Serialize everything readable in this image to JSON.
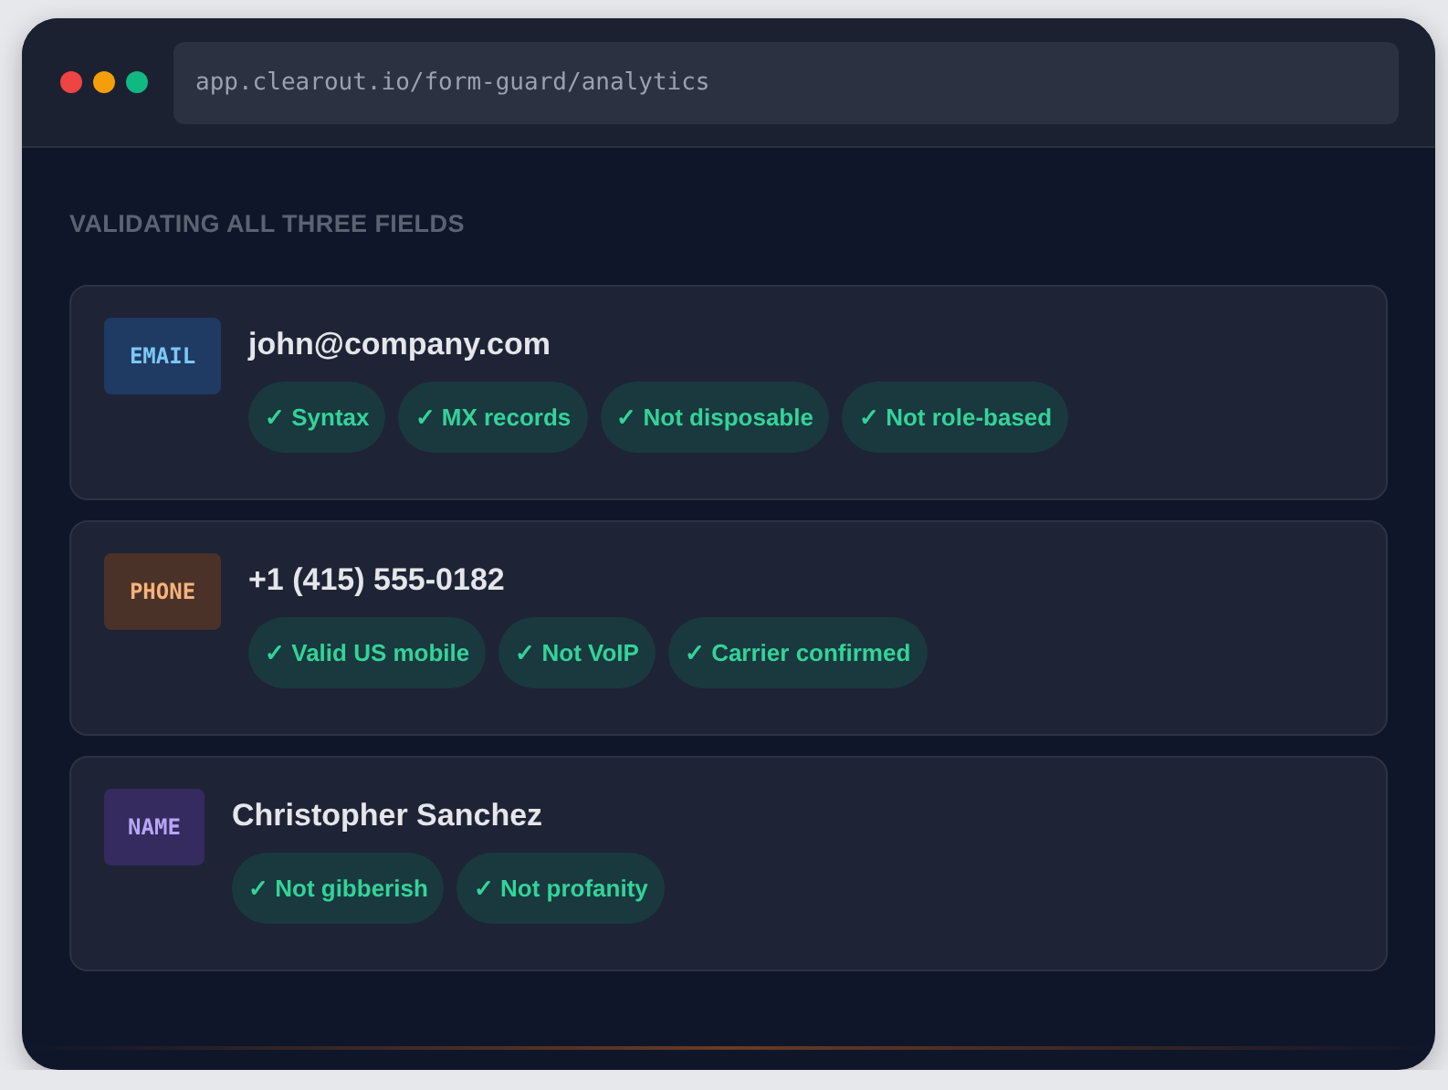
{
  "window": {
    "url": "app.clearout.io/form-guard/analytics"
  },
  "heading": "VALIDATING ALL THREE FIELDS",
  "fields": [
    {
      "kind": "email",
      "label": "EMAIL",
      "value": "john@company.com",
      "checks": [
        "✓ Syntax",
        "✓ MX records",
        "✓ Not disposable",
        "✓ Not role-based"
      ]
    },
    {
      "kind": "phone",
      "label": "PHONE",
      "value": "+1 (415) 555-0182",
      "checks": [
        "✓ Valid US mobile",
        "✓ Not VoIP",
        "✓ Carrier confirmed"
      ]
    },
    {
      "kind": "name",
      "label": "NAME",
      "value": "Christopher Sanchez",
      "checks": [
        "✓ Not gibberish",
        "✓ Not profanity"
      ]
    }
  ]
}
